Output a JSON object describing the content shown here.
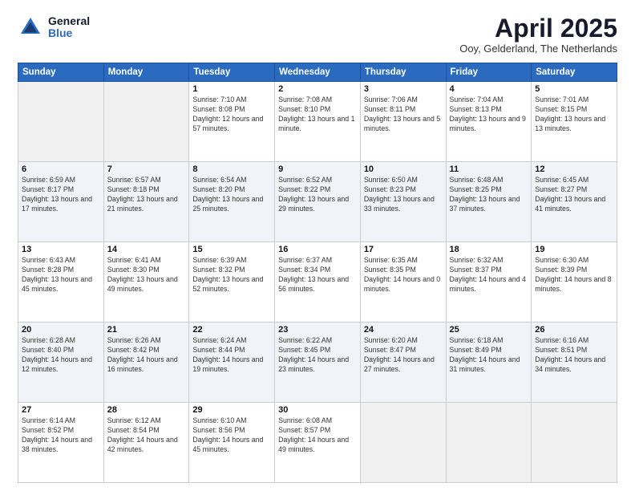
{
  "header": {
    "logo_general": "General",
    "logo_blue": "Blue",
    "month_title": "April 2025",
    "subtitle": "Ooy, Gelderland, The Netherlands"
  },
  "days_of_week": [
    "Sunday",
    "Monday",
    "Tuesday",
    "Wednesday",
    "Thursday",
    "Friday",
    "Saturday"
  ],
  "weeks": [
    [
      {
        "day": "",
        "sunrise": "",
        "sunset": "",
        "daylight": ""
      },
      {
        "day": "",
        "sunrise": "",
        "sunset": "",
        "daylight": ""
      },
      {
        "day": "1",
        "sunrise": "Sunrise: 7:10 AM",
        "sunset": "Sunset: 8:08 PM",
        "daylight": "Daylight: 12 hours and 57 minutes."
      },
      {
        "day": "2",
        "sunrise": "Sunrise: 7:08 AM",
        "sunset": "Sunset: 8:10 PM",
        "daylight": "Daylight: 13 hours and 1 minute."
      },
      {
        "day": "3",
        "sunrise": "Sunrise: 7:06 AM",
        "sunset": "Sunset: 8:11 PM",
        "daylight": "Daylight: 13 hours and 5 minutes."
      },
      {
        "day": "4",
        "sunrise": "Sunrise: 7:04 AM",
        "sunset": "Sunset: 8:13 PM",
        "daylight": "Daylight: 13 hours and 9 minutes."
      },
      {
        "day": "5",
        "sunrise": "Sunrise: 7:01 AM",
        "sunset": "Sunset: 8:15 PM",
        "daylight": "Daylight: 13 hours and 13 minutes."
      }
    ],
    [
      {
        "day": "6",
        "sunrise": "Sunrise: 6:59 AM",
        "sunset": "Sunset: 8:17 PM",
        "daylight": "Daylight: 13 hours and 17 minutes."
      },
      {
        "day": "7",
        "sunrise": "Sunrise: 6:57 AM",
        "sunset": "Sunset: 8:18 PM",
        "daylight": "Daylight: 13 hours and 21 minutes."
      },
      {
        "day": "8",
        "sunrise": "Sunrise: 6:54 AM",
        "sunset": "Sunset: 8:20 PM",
        "daylight": "Daylight: 13 hours and 25 minutes."
      },
      {
        "day": "9",
        "sunrise": "Sunrise: 6:52 AM",
        "sunset": "Sunset: 8:22 PM",
        "daylight": "Daylight: 13 hours and 29 minutes."
      },
      {
        "day": "10",
        "sunrise": "Sunrise: 6:50 AM",
        "sunset": "Sunset: 8:23 PM",
        "daylight": "Daylight: 13 hours and 33 minutes."
      },
      {
        "day": "11",
        "sunrise": "Sunrise: 6:48 AM",
        "sunset": "Sunset: 8:25 PM",
        "daylight": "Daylight: 13 hours and 37 minutes."
      },
      {
        "day": "12",
        "sunrise": "Sunrise: 6:45 AM",
        "sunset": "Sunset: 8:27 PM",
        "daylight": "Daylight: 13 hours and 41 minutes."
      }
    ],
    [
      {
        "day": "13",
        "sunrise": "Sunrise: 6:43 AM",
        "sunset": "Sunset: 8:28 PM",
        "daylight": "Daylight: 13 hours and 45 minutes."
      },
      {
        "day": "14",
        "sunrise": "Sunrise: 6:41 AM",
        "sunset": "Sunset: 8:30 PM",
        "daylight": "Daylight: 13 hours and 49 minutes."
      },
      {
        "day": "15",
        "sunrise": "Sunrise: 6:39 AM",
        "sunset": "Sunset: 8:32 PM",
        "daylight": "Daylight: 13 hours and 52 minutes."
      },
      {
        "day": "16",
        "sunrise": "Sunrise: 6:37 AM",
        "sunset": "Sunset: 8:34 PM",
        "daylight": "Daylight: 13 hours and 56 minutes."
      },
      {
        "day": "17",
        "sunrise": "Sunrise: 6:35 AM",
        "sunset": "Sunset: 8:35 PM",
        "daylight": "Daylight: 14 hours and 0 minutes."
      },
      {
        "day": "18",
        "sunrise": "Sunrise: 6:32 AM",
        "sunset": "Sunset: 8:37 PM",
        "daylight": "Daylight: 14 hours and 4 minutes."
      },
      {
        "day": "19",
        "sunrise": "Sunrise: 6:30 AM",
        "sunset": "Sunset: 8:39 PM",
        "daylight": "Daylight: 14 hours and 8 minutes."
      }
    ],
    [
      {
        "day": "20",
        "sunrise": "Sunrise: 6:28 AM",
        "sunset": "Sunset: 8:40 PM",
        "daylight": "Daylight: 14 hours and 12 minutes."
      },
      {
        "day": "21",
        "sunrise": "Sunrise: 6:26 AM",
        "sunset": "Sunset: 8:42 PM",
        "daylight": "Daylight: 14 hours and 16 minutes."
      },
      {
        "day": "22",
        "sunrise": "Sunrise: 6:24 AM",
        "sunset": "Sunset: 8:44 PM",
        "daylight": "Daylight: 14 hours and 19 minutes."
      },
      {
        "day": "23",
        "sunrise": "Sunrise: 6:22 AM",
        "sunset": "Sunset: 8:45 PM",
        "daylight": "Daylight: 14 hours and 23 minutes."
      },
      {
        "day": "24",
        "sunrise": "Sunrise: 6:20 AM",
        "sunset": "Sunset: 8:47 PM",
        "daylight": "Daylight: 14 hours and 27 minutes."
      },
      {
        "day": "25",
        "sunrise": "Sunrise: 6:18 AM",
        "sunset": "Sunset: 8:49 PM",
        "daylight": "Daylight: 14 hours and 31 minutes."
      },
      {
        "day": "26",
        "sunrise": "Sunrise: 6:16 AM",
        "sunset": "Sunset: 8:51 PM",
        "daylight": "Daylight: 14 hours and 34 minutes."
      }
    ],
    [
      {
        "day": "27",
        "sunrise": "Sunrise: 6:14 AM",
        "sunset": "Sunset: 8:52 PM",
        "daylight": "Daylight: 14 hours and 38 minutes."
      },
      {
        "day": "28",
        "sunrise": "Sunrise: 6:12 AM",
        "sunset": "Sunset: 8:54 PM",
        "daylight": "Daylight: 14 hours and 42 minutes."
      },
      {
        "day": "29",
        "sunrise": "Sunrise: 6:10 AM",
        "sunset": "Sunset: 8:56 PM",
        "daylight": "Daylight: 14 hours and 45 minutes."
      },
      {
        "day": "30",
        "sunrise": "Sunrise: 6:08 AM",
        "sunset": "Sunset: 8:57 PM",
        "daylight": "Daylight: 14 hours and 49 minutes."
      },
      {
        "day": "",
        "sunrise": "",
        "sunset": "",
        "daylight": ""
      },
      {
        "day": "",
        "sunrise": "",
        "sunset": "",
        "daylight": ""
      },
      {
        "day": "",
        "sunrise": "",
        "sunset": "",
        "daylight": ""
      }
    ]
  ]
}
